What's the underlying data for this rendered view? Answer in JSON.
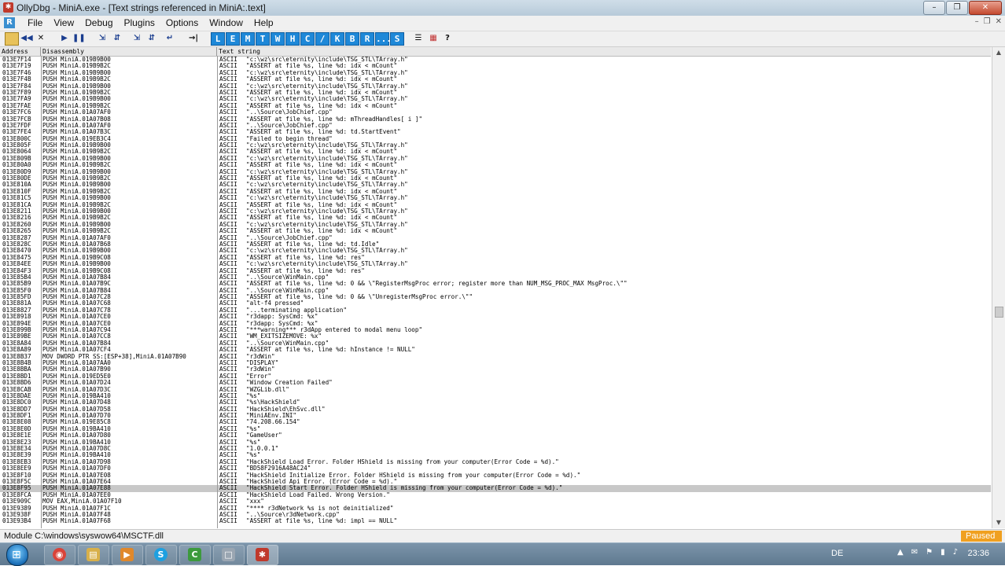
{
  "window": {
    "title": "OllyDbg - MiniA.exe - [Text strings referenced in MiniA:.text]",
    "minimize_glyph": "–",
    "maximize_glyph": "❐",
    "close_glyph": "✕"
  },
  "menubar": {
    "logo": "R",
    "items": [
      "File",
      "View",
      "Debug",
      "Plugins",
      "Options",
      "Window",
      "Help"
    ],
    "mdi": [
      "–",
      "❐",
      "✕"
    ]
  },
  "toolbar": {
    "icons": [
      "open-icon",
      "restart-icon",
      "close-icon",
      "run-icon",
      "pause-icon",
      "step-into-icon",
      "step-over-icon",
      "trace-into-icon",
      "trace-over-icon",
      "execute-till-return-icon",
      "goto-icon"
    ],
    "letters": [
      "L",
      "E",
      "M",
      "T",
      "W",
      "H",
      "C",
      "/",
      "K",
      "B",
      "R",
      "...",
      "S"
    ],
    "end_icons": [
      "list-icon",
      "grid-icon",
      "help-icon"
    ]
  },
  "list": {
    "headers": {
      "address": "Address",
      "disassembly": "Disassembly",
      "text": "Text string"
    },
    "selected_index": 65,
    "rows": [
      [
        "013E7F14",
        "PUSH MiniA.019B9B00",
        "ASCII",
        "\"c:\\wz\\src\\eternity\\include\\TSG_STL\\TArray.h\""
      ],
      [
        "013E7F19",
        "PUSH MiniA.019B9B2C",
        "ASCII",
        "\"ASSERT at file %s, line %d: idx < mCount\""
      ],
      [
        "013E7F46",
        "PUSH MiniA.019B9B00",
        "ASCII",
        "\"c:\\wz\\src\\eternity\\include\\TSG_STL\\TArray.h\""
      ],
      [
        "013E7F4B",
        "PUSH MiniA.019B9B2C",
        "ASCII",
        "\"ASSERT at file %s, line %d: idx < mCount\""
      ],
      [
        "013E7F84",
        "PUSH MiniA.019B9B00",
        "ASCII",
        "\"c:\\wz\\src\\eternity\\include\\TSG_STL\\TArray.h\""
      ],
      [
        "013E7F89",
        "PUSH MiniA.019B9B2C",
        "ASCII",
        "\"ASSERT at file %s, line %d: idx < mCount\""
      ],
      [
        "013E7FA9",
        "PUSH MiniA.019B9B00",
        "ASCII",
        "\"c:\\wz\\src\\eternity\\include\\TSG_STL\\TArray.h\""
      ],
      [
        "013E7FAE",
        "PUSH MiniA.019B9B2C",
        "ASCII",
        "\"ASSERT at file %s, line %d: idx < mCount\""
      ],
      [
        "013E7FC6",
        "PUSH MiniA.01A07AF0",
        "ASCII",
        "\"..\\Source\\JobChief.cpp\""
      ],
      [
        "013E7FCB",
        "PUSH MiniA.01A07B08",
        "ASCII",
        "\"ASSERT at file %s, line %d: mThreadHandles[ i ]\""
      ],
      [
        "013E7FDF",
        "PUSH MiniA.01A07AF0",
        "ASCII",
        "\"..\\Source\\JobChief.cpp\""
      ],
      [
        "013E7FE4",
        "PUSH MiniA.01A07B3C",
        "ASCII",
        "\"ASSERT at file %s, line %d: td.StartEvent\""
      ],
      [
        "013E800C",
        "PUSH MiniA.019EB3C4",
        "ASCII",
        "\"Failed to begin thread\""
      ],
      [
        "013E805F",
        "PUSH MiniA.019B9B00",
        "ASCII",
        "\"c:\\wz\\src\\eternity\\include\\TSG_STL\\TArray.h\""
      ],
      [
        "013E8064",
        "PUSH MiniA.019B9B2C",
        "ASCII",
        "\"ASSERT at file %s, line %d: idx < mCount\""
      ],
      [
        "013E809B",
        "PUSH MiniA.019B9B00",
        "ASCII",
        "\"c:\\wz\\src\\eternity\\include\\TSG_STL\\TArray.h\""
      ],
      [
        "013E80A0",
        "PUSH MiniA.019B9B2C",
        "ASCII",
        "\"ASSERT at file %s, line %d: idx < mCount\""
      ],
      [
        "013E80D9",
        "PUSH MiniA.019B9B00",
        "ASCII",
        "\"c:\\wz\\src\\eternity\\include\\TSG_STL\\TArray.h\""
      ],
      [
        "013E80DE",
        "PUSH MiniA.019B9B2C",
        "ASCII",
        "\"ASSERT at file %s, line %d: idx < mCount\""
      ],
      [
        "013E810A",
        "PUSH MiniA.019B9B00",
        "ASCII",
        "\"c:\\wz\\src\\eternity\\include\\TSG_STL\\TArray.h\""
      ],
      [
        "013E810F",
        "PUSH MiniA.019B9B2C",
        "ASCII",
        "\"ASSERT at file %s, line %d: idx < mCount\""
      ],
      [
        "013E81C5",
        "PUSH MiniA.019B9B00",
        "ASCII",
        "\"c:\\wz\\src\\eternity\\include\\TSG_STL\\TArray.h\""
      ],
      [
        "013E81CA",
        "PUSH MiniA.019B9B2C",
        "ASCII",
        "\"ASSERT at file %s, line %d: idx < mCount\""
      ],
      [
        "013E8211",
        "PUSH MiniA.019B9B00",
        "ASCII",
        "\"c:\\wz\\src\\eternity\\include\\TSG_STL\\TArray.h\""
      ],
      [
        "013E8216",
        "PUSH MiniA.019B9B2C",
        "ASCII",
        "\"ASSERT at file %s, line %d: idx < mCount\""
      ],
      [
        "013E8260",
        "PUSH MiniA.019B9B00",
        "ASCII",
        "\"c:\\wz\\src\\eternity\\include\\TSG_STL\\TArray.h\""
      ],
      [
        "013E8265",
        "PUSH MiniA.019B9B2C",
        "ASCII",
        "\"ASSERT at file %s, line %d: idx < mCount\""
      ],
      [
        "013E8287",
        "PUSH MiniA.01A07AF0",
        "ASCII",
        "\"..\\Source\\JobChief.cpp\""
      ],
      [
        "013E828C",
        "PUSH MiniA.01A07B68",
        "ASCII",
        "\"ASSERT at file %s, line %d: td.Idle\""
      ],
      [
        "013E8470",
        "PUSH MiniA.019B9B00",
        "ASCII",
        "\"c:\\wz\\src\\eternity\\include\\TSG_STL\\TArray.h\""
      ],
      [
        "013E8475",
        "PUSH MiniA.019B9C08",
        "ASCII",
        "\"ASSERT at file %s, line %d: res\""
      ],
      [
        "013E84EE",
        "PUSH MiniA.019B9B00",
        "ASCII",
        "\"c:\\wz\\src\\eternity\\include\\TSG_STL\\TArray.h\""
      ],
      [
        "013E84F3",
        "PUSH MiniA.019B9C08",
        "ASCII",
        "\"ASSERT at file %s, line %d: res\""
      ],
      [
        "013E85B4",
        "PUSH MiniA.01A07B84",
        "ASCII",
        "\"..\\Source\\WinMain.cpp\""
      ],
      [
        "013E85B9",
        "PUSH MiniA.01A07B9C",
        "ASCII",
        "\"ASSERT at file %s, line %d: 0 && \\\"RegisterMsgProc error; register more than NUM_MSG_PROC_MAX MsgProc.\\\"\""
      ],
      [
        "013E85F0",
        "PUSH MiniA.01A07B84",
        "ASCII",
        "\"..\\Source\\WinMain.cpp\""
      ],
      [
        "013E85FD",
        "PUSH MiniA.01A07C28",
        "ASCII",
        "\"ASSERT at file %s, line %d: 0 && \\\"UnregisterMsgProc error.\\\"\""
      ],
      [
        "013E881A",
        "PUSH MiniA.01A07C68",
        "ASCII",
        "\"alt-f4 pressed\""
      ],
      [
        "013E8827",
        "PUSH MiniA.01A07C78",
        "ASCII",
        "\"...terminating application\""
      ],
      [
        "013E8918",
        "PUSH MiniA.01A07CE0",
        "ASCII",
        "\"r3dapp: SysCmd: %x\""
      ],
      [
        "013E894E",
        "PUSH MiniA.01A07CE0",
        "ASCII",
        "\"r3dapp: SysCmd: %x\""
      ],
      [
        "013E899B",
        "PUSH MiniA.01A07C94",
        "ASCII",
        "\"***warning*** r3dApp entered to modal menu loop\""
      ],
      [
        "013E89BE",
        "PUSH MiniA.01A07CC8",
        "ASCII",
        "\"WM_EXITSIZEMOVE: %x\""
      ],
      [
        "013E8A84",
        "PUSH MiniA.01A07B84",
        "ASCII",
        "\"..\\Source\\WinMain.cpp\""
      ],
      [
        "013E8A89",
        "PUSH MiniA.01A07CF4",
        "ASCII",
        "\"ASSERT at file %s, line %d: hInstance != NULL\""
      ],
      [
        "013E8B37",
        "MOV DWORD PTR SS:[ESP+38],MiniA.01A07B90",
        "ASCII",
        "\"r3dWin\""
      ],
      [
        "013E8B4B",
        "PUSH MiniA.01A07AA0",
        "ASCII",
        "\"DISPLAY\""
      ],
      [
        "013E8BBA",
        "PUSH MiniA.01A07B90",
        "ASCII",
        "\"r3dWin\""
      ],
      [
        "013E8BD1",
        "PUSH MiniA.019ED5E0",
        "ASCII",
        "\"Error\""
      ],
      [
        "013E8BD6",
        "PUSH MiniA.01A07D24",
        "ASCII",
        "\"Window Creation Failed\""
      ],
      [
        "013E8CAB",
        "PUSH MiniA.01A07D3C",
        "ASCII",
        "\"WZGLib.dll\""
      ],
      [
        "013E8DAE",
        "PUSH MiniA.019BA410",
        "ASCII",
        "\"%s\""
      ],
      [
        "013E8DC0",
        "PUSH MiniA.01A07D48",
        "ASCII",
        "\"%s\\HackShield\""
      ],
      [
        "013E8DD7",
        "PUSH MiniA.01A07D58",
        "ASCII",
        "\"HackShield\\EhSvc.dll\""
      ],
      [
        "013E8DF1",
        "PUSH MiniA.01A07D70",
        "ASCII",
        "\"MiniAEnv.INI\""
      ],
      [
        "013E8E08",
        "PUSH MiniA.019E85C8",
        "ASCII",
        "\"74.208.66.154\""
      ],
      [
        "013E8E0D",
        "PUSH MiniA.019BA410",
        "ASCII",
        "\"%s\""
      ],
      [
        "013E8E1E",
        "PUSH MiniA.01A07D80",
        "ASCII",
        "\"GameUser\""
      ],
      [
        "013E8E23",
        "PUSH MiniA.019BA410",
        "ASCII",
        "\"%s\""
      ],
      [
        "013E8E34",
        "PUSH MiniA.01A07D8C",
        "ASCII",
        "\"1.0.0.1\""
      ],
      [
        "013E8E39",
        "PUSH MiniA.019BA410",
        "ASCII",
        "\"%s\""
      ],
      [
        "013E8EB3",
        "PUSH MiniA.01A07D98",
        "ASCII",
        "\"HackShield Load Error. Folder HShield is missing from your computer(Error Code = %d).\""
      ],
      [
        "013E8EE9",
        "PUSH MiniA.01A07DF0",
        "ASCII",
        "\"BD58F2916A48AC24\""
      ],
      [
        "013E8F10",
        "PUSH MiniA.01A07E08",
        "ASCII",
        "\"HackShield Initialize Error. Folder HShield is missing from your computer(Error Code = %d).\""
      ],
      [
        "013E8F5C",
        "PUSH MiniA.01A07E64",
        "ASCII",
        "\"HackShield Api Error. (Error Code = %d).\""
      ],
      [
        "013E8F95",
        "PUSH MiniA.01A07E88",
        "ASCII",
        "\"HackShield Start Error. Folder HShield is missing from your computer(Error Code = %d).\""
      ],
      [
        "013E8FCA",
        "PUSH MiniA.01A07EE0",
        "ASCII",
        "\"HackShield Load Failed. Wrong Version.\""
      ],
      [
        "013E909C",
        "MOV EAX,MiniA.01A07F10",
        "ASCII",
        "\"xxx\""
      ],
      [
        "013E9389",
        "PUSH MiniA.01A07F1C",
        "ASCII",
        "\"**** r3dNetwork %s is not deinitialized\""
      ],
      [
        "013E938F",
        "PUSH MiniA.01A07F48",
        "ASCII",
        "\"..\\Source\\r3dNetwork.cpp\""
      ],
      [
        "013E93B4",
        "PUSH MiniA.01A07F68",
        "ASCII",
        "\"ASSERT at file %s, line %d: impl == NULL\""
      ]
    ]
  },
  "statusbar": {
    "module_text": "Module C:\\windows\\syswow64\\MSCTF.dll",
    "state": "Paused",
    "state_color": "#f0a020"
  },
  "taskbar": {
    "start_glyph": "⊞",
    "apps": [
      {
        "icon": "chrome-icon",
        "glyph": "◉",
        "color": "#d9433a"
      },
      {
        "icon": "explorer-icon",
        "glyph": "▤",
        "color": "#d8b04a"
      },
      {
        "icon": "media-icon",
        "glyph": "▶",
        "color": "#e0882b"
      },
      {
        "icon": "skype-icon",
        "glyph": "S",
        "color": "#1ea0e0"
      },
      {
        "icon": "cheatengine-icon",
        "glyph": "C",
        "color": "#3d9a3d"
      },
      {
        "icon": "notepad-icon",
        "glyph": "□",
        "color": "#9aa6b2"
      },
      {
        "icon": "ollydbg-icon",
        "glyph": "✱",
        "color": "#c0392b"
      }
    ],
    "language": "DE",
    "tray_icons": [
      "▲",
      "✉",
      "⚑",
      "▮",
      "♪"
    ],
    "clock": "23:36"
  }
}
